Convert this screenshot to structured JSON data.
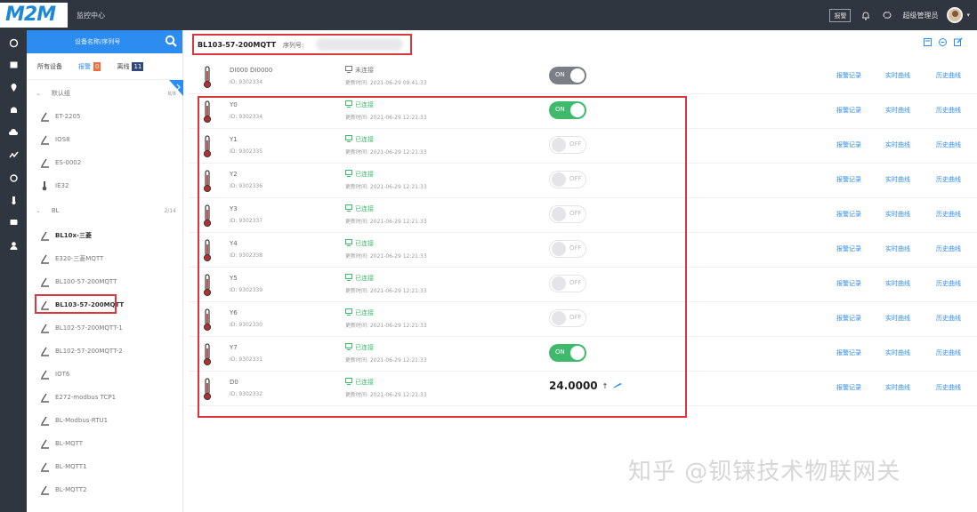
{
  "app": {
    "logo": "M2M",
    "top_center": "监控中心",
    "top_button": "报警",
    "user": "超级管理员"
  },
  "panel": {
    "search_label": "设备名称/序列号",
    "tabs": [
      {
        "label": "所有设备",
        "badge": ""
      },
      {
        "label": "报警",
        "badge": "0"
      },
      {
        "label": "离线",
        "badge": "11"
      }
    ],
    "groups": [
      {
        "label": "默认组",
        "count": "8/8"
      },
      {
        "label": "BL",
        "count": "2/14"
      }
    ],
    "items": [
      {
        "label": "ET-2205"
      },
      {
        "label": "IOS8"
      },
      {
        "label": "ES-0002"
      },
      {
        "label": "IE32"
      },
      {
        "label": "BL10x-三菱"
      },
      {
        "label": "E320-三菱MQTT"
      },
      {
        "label": "BL100-57-200MQTT"
      },
      {
        "label": "BL103-57-200MQTT"
      },
      {
        "label": "BL102-57-200MQTT-1"
      },
      {
        "label": "BL102-57-200MQTT-2"
      },
      {
        "label": "IOT6"
      },
      {
        "label": "E272-modbus TCP1"
      },
      {
        "label": "BL-Modbus-RTU1"
      },
      {
        "label": "BL-MQTT"
      },
      {
        "label": "BL-MQTT1"
      },
      {
        "label": "BL-MQTT2"
      }
    ]
  },
  "header": {
    "title": "BL103-57-200MQTT",
    "serial_label": "序列号:"
  },
  "rows": [
    {
      "name": "DI000 DI0000",
      "id": "ID: 9302334",
      "status": "未连接",
      "time": "更新时间: 2021-06-29 09:41:33",
      "control": "toggle",
      "state": "ON",
      "variant": "gray"
    },
    {
      "name": "Y0",
      "id": "ID: 9302334",
      "status": "已连接",
      "time": "更新时间: 2021-06-29 12:21:33",
      "control": "toggle",
      "state": "ON",
      "variant": "on"
    },
    {
      "name": "Y1",
      "id": "ID: 9302335",
      "status": "已连接",
      "time": "更新时间: 2021-06-29 12:21:33",
      "control": "toggle",
      "state": "OFF",
      "variant": "off"
    },
    {
      "name": "Y2",
      "id": "ID: 9302336",
      "status": "已连接",
      "time": "更新时间: 2021-06-29 12:21:33",
      "control": "toggle",
      "state": "OFF",
      "variant": "off"
    },
    {
      "name": "Y3",
      "id": "ID: 9302337",
      "status": "已连接",
      "time": "更新时间: 2021-06-29 12:21:33",
      "control": "toggle",
      "state": "OFF",
      "variant": "off"
    },
    {
      "name": "Y4",
      "id": "ID: 9302338",
      "status": "已连接",
      "time": "更新时间: 2021-06-29 12:21:33",
      "control": "toggle",
      "state": "OFF",
      "variant": "off"
    },
    {
      "name": "Y5",
      "id": "ID: 9302339",
      "status": "已连接",
      "time": "更新时间: 2021-06-29 12:21:33",
      "control": "toggle",
      "state": "OFF",
      "variant": "off"
    },
    {
      "name": "Y6",
      "id": "ID: 9302330",
      "status": "已连接",
      "time": "更新时间: 2021-06-29 12:21:33",
      "control": "toggle",
      "state": "OFF",
      "variant": "off"
    },
    {
      "name": "Y7",
      "id": "ID: 9302331",
      "status": "已连接",
      "time": "更新时间: 2021-06-29 12:21:33",
      "control": "toggle",
      "state": "ON",
      "variant": "on"
    },
    {
      "name": "D0",
      "id": "ID: 9302332",
      "status": "已连接",
      "time": "更新时间: 2021-06-29 12:21:33",
      "control": "value",
      "value": "24.0000",
      "arrow": "↑"
    }
  ],
  "actions": [
    "报警记录",
    "实时曲线",
    "历史曲线"
  ],
  "watermark": "知乎 @钡铼技术物联网关",
  "colors": {
    "accent": "#2d8cf0",
    "on": "#3fb96b",
    "highlight": "#d9363e",
    "sidebar": "#303640"
  }
}
